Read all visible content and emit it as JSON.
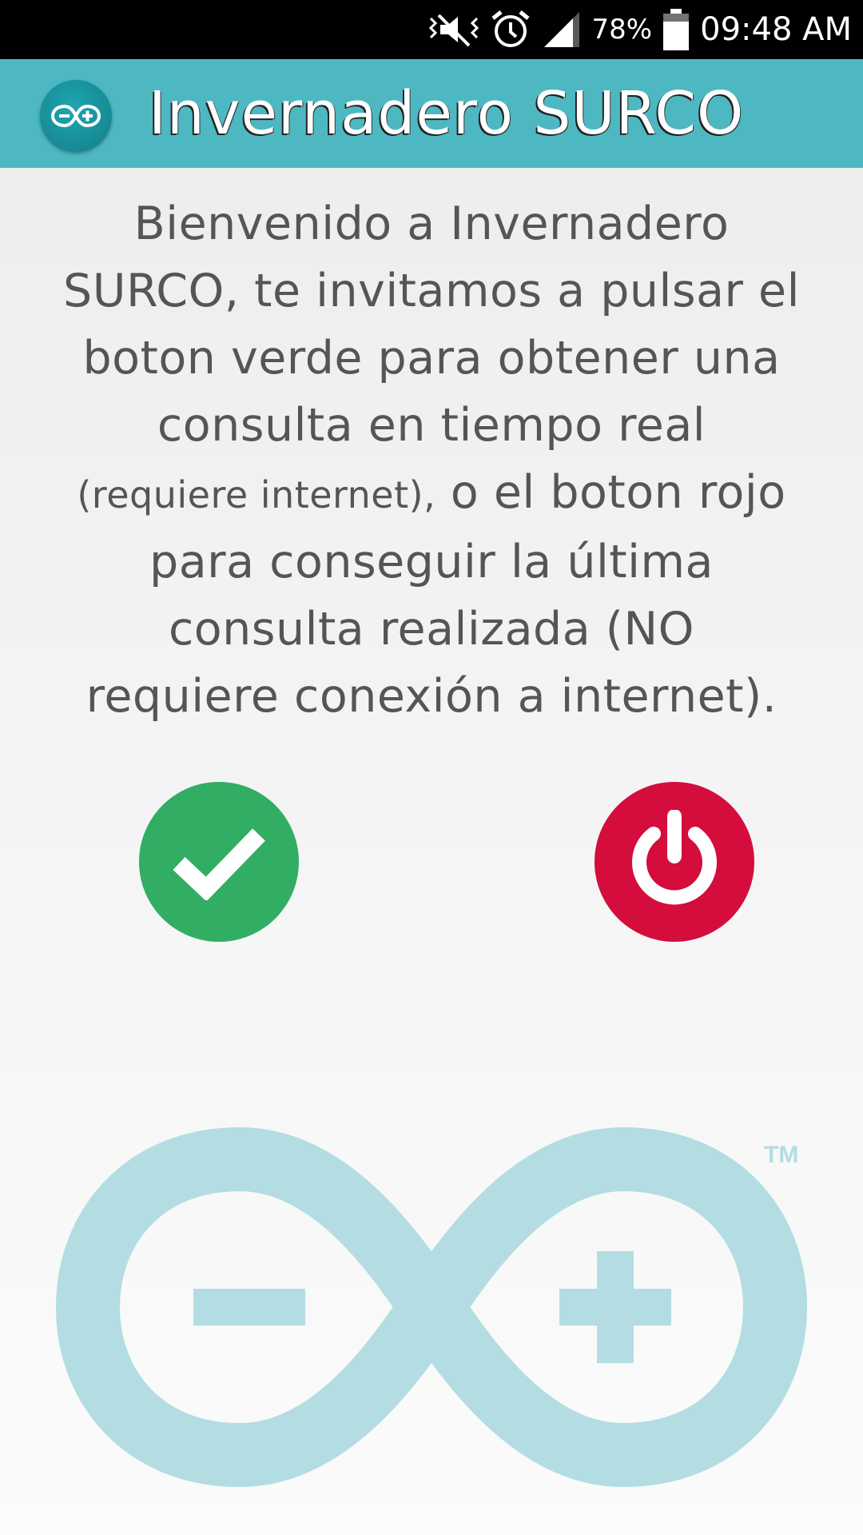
{
  "status_bar": {
    "battery_percent": "78%",
    "time": "09:48 AM",
    "icons": [
      "vibrate-mute-icon",
      "alarm-icon",
      "signal-icon",
      "battery-icon"
    ]
  },
  "app_bar": {
    "title": "Invernadero SURCO",
    "logo_icon": "arduino-logo-icon",
    "color": "#4db8c2"
  },
  "welcome": {
    "lines": [
      "Bienvenido a Invernadero",
      "SURCO, te invitamos a pulsar el",
      "boton verde para obtener una",
      "consulta en tiempo real",
      "(requiere internet),",
      " o el boton rojo",
      "para conseguir la última",
      "consulta realizada (NO",
      "requiere conexión a internet)."
    ]
  },
  "buttons": {
    "online": {
      "icon": "checkmark-icon",
      "color": "#31ad64"
    },
    "offline": {
      "icon": "power-icon",
      "color": "#d40d3c"
    }
  },
  "logo": {
    "icon": "arduino-infinity-logo",
    "color": "#b3dde2",
    "trademark": "TM"
  }
}
